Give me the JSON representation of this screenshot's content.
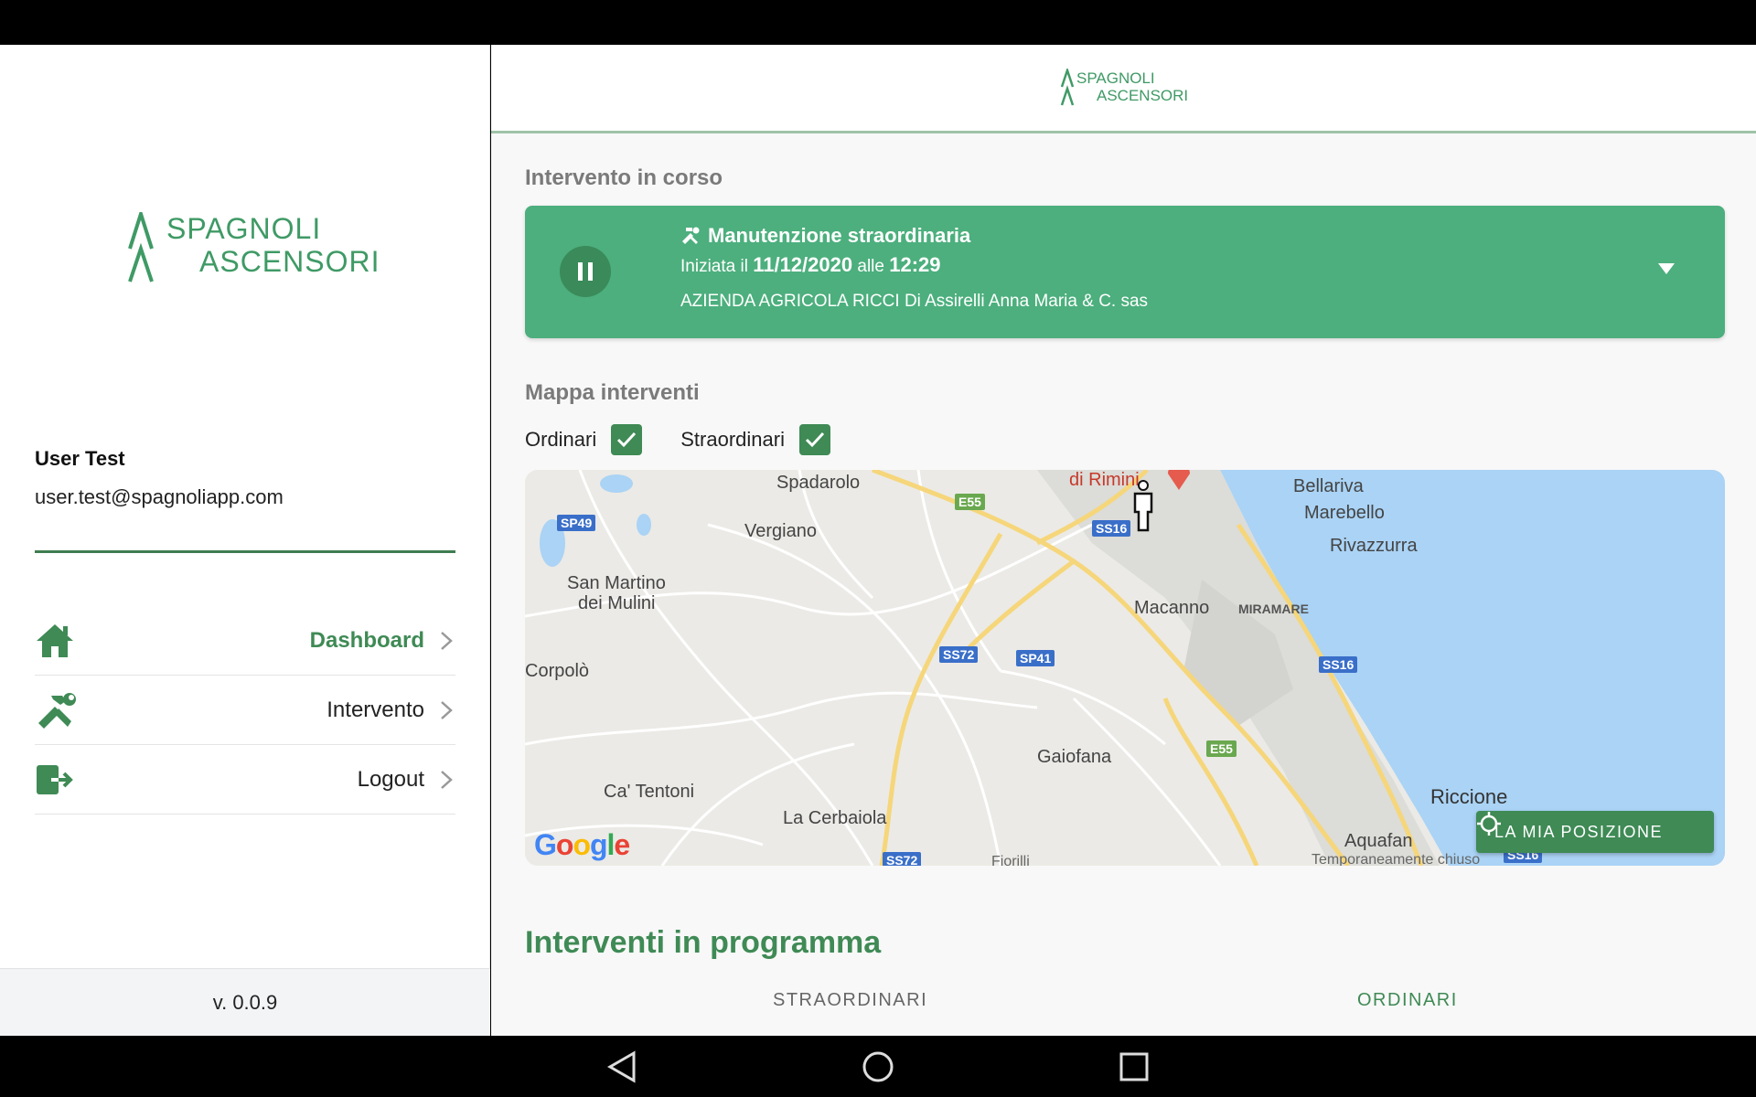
{
  "brand": {
    "logo_line1": "SPAGNOLI",
    "logo_line2": "ASCENSORI",
    "color_primary": "#3f8a55",
    "color_card": "#4caf7d"
  },
  "user": {
    "name": "User Test",
    "email": "user.test@spagnoliapp.com"
  },
  "menu": [
    {
      "label": "Dashboard",
      "icon": "home-icon",
      "active": true
    },
    {
      "label": "Intervento",
      "icon": "tools-icon",
      "active": false
    },
    {
      "label": "Logout",
      "icon": "logout-icon",
      "active": false
    }
  ],
  "version": "v. 0.0.9",
  "current": {
    "section_title": "Intervento in corso",
    "type": "Manutenzione straordinaria",
    "started_prefix": "Iniziata il",
    "date": "11/12/2020",
    "time_prefix": "alle",
    "time": "12:29",
    "client": "AZIENDA AGRICOLA RICCI Di Assirelli Anna Maria & C. sas"
  },
  "map_section": {
    "title": "Mappa interventi",
    "filter_ordinari": "Ordinari",
    "filter_straordinari": "Straordinari",
    "my_position": "LA MIA POSIZIONE",
    "places": [
      "Spadarolo",
      "di Rimini",
      "Bellariva",
      "Marebello",
      "Rivazzurra",
      "Vergiano",
      "San Martino",
      "dei Mulini",
      "Macanno",
      "MIRAMARE",
      "Corpolò",
      "Gaiofana",
      "Ca' Tentoni",
      "La Cerbaiola",
      "Riccione",
      "Aquafan",
      "Temporaneamente chiuso",
      "Fiorilli"
    ],
    "roads": [
      "SP49",
      "E55",
      "SS16",
      "SS72",
      "SP41",
      "SS16",
      "E55",
      "SS72",
      "SS16"
    ],
    "attribution": "Google"
  },
  "programma": {
    "title": "Interventi in programma",
    "tab_straordinari": "STRAORDINARI",
    "tab_ordinari": "ORDINARI"
  }
}
